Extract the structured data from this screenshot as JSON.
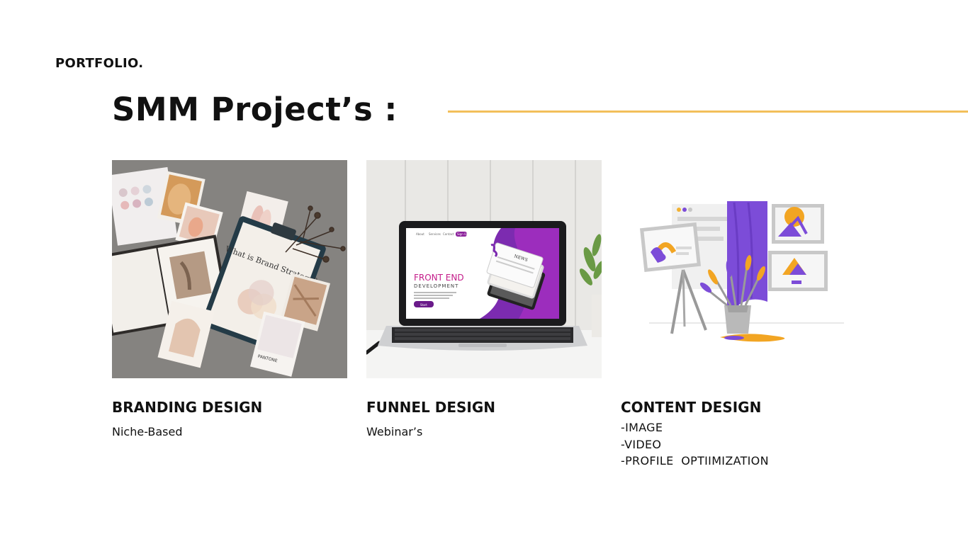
{
  "header": {
    "brand": "PORTFOLIO.",
    "title": "SMM Project’s :",
    "accent_color": "#f2bf5a"
  },
  "projects": [
    {
      "title": "BRANDING DESIGN",
      "subtitle": "Niche-Based",
      "image": {
        "clipboard_text": "What is Brand Strategy?",
        "swatch_label": "PANTONE"
      }
    },
    {
      "title": "FUNNEL DESIGN",
      "subtitle": "Webinar’s",
      "image": {
        "nav_items": [
          "About",
          "Services",
          "Contact",
          "Sign Up"
        ],
        "headline": "FRONT END",
        "subheadline": "DEVELOPMENT",
        "cta": "Start",
        "phone_title": "NEWS"
      }
    },
    {
      "title": "CONTENT DESIGN",
      "items": [
        "-IMAGE",
        "-VIDEO",
        "-PROFILE  OPTIIMIZATION"
      ]
    }
  ]
}
